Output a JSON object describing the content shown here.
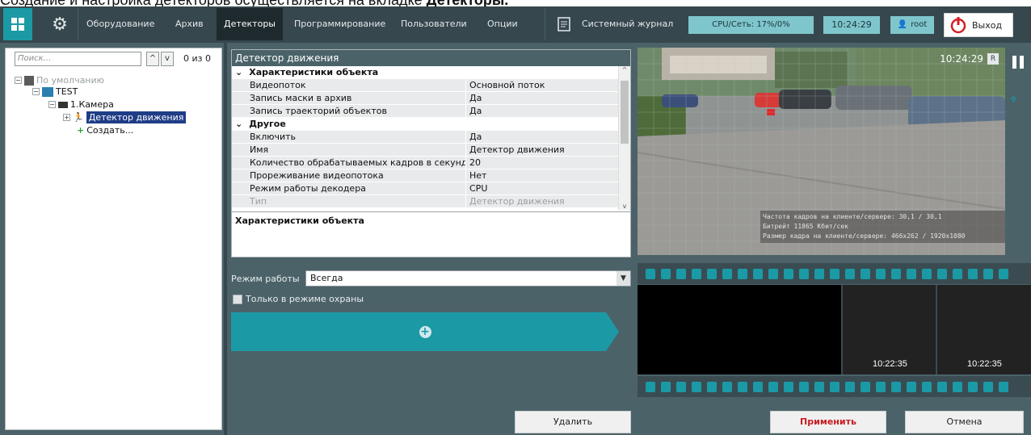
{
  "caption": {
    "text": "Создание и настройка детекторов осуществляется на вкладке ",
    "bold": "Детекторы."
  },
  "topbar": {
    "tabs": [
      "Оборудование",
      "Архив",
      "Детекторы",
      "Программирование",
      "Пользователи",
      "Опции"
    ],
    "active_tab": "Детекторы",
    "journal": "Системный журнал",
    "cpu": "CPU/Сеть: 17%/0%",
    "time": "10:24:29",
    "user": "root",
    "exit": "Выход"
  },
  "tree": {
    "search_placeholder": "Поиск...",
    "count": "0 из 0",
    "items": [
      "По умолчанию",
      "TEST",
      "1.Камера",
      "Детектор движения",
      "Создать..."
    ]
  },
  "props": {
    "title": "Детектор движения",
    "group1": "Характеристики объекта",
    "rows1": [
      {
        "k": "Видеопоток",
        "v": "Основной поток"
      },
      {
        "k": "Запись маски в архив",
        "v": "Да"
      },
      {
        "k": "Запись траекторий объектов",
        "v": "Да"
      }
    ],
    "group2": "Другое",
    "rows2": [
      {
        "k": "Включить",
        "v": "Да"
      },
      {
        "k": "Имя",
        "v": "Детектор движения"
      },
      {
        "k": "Количество обрабатываемых кадров в секунду",
        "v": "20"
      },
      {
        "k": "Прореживание видеопотока",
        "v": "Нет"
      },
      {
        "k": "Режим работы декодера",
        "v": "CPU"
      },
      {
        "k": "Тип",
        "v": "Детектор движения"
      }
    ],
    "description": "Характеристики объекта"
  },
  "mode": {
    "label": "Режим работы",
    "value": "Всегда",
    "guard_label": "Только в режиме охраны"
  },
  "buttons": {
    "delete": "Удалить",
    "apply": "Применить",
    "cancel": "Отмена"
  },
  "video": {
    "time": "10:24:29",
    "r_badge": "R",
    "stat1": "Частота кадров на клиенте/сервере: 30,1 / 30,1",
    "stat2": "Битрейт 11865 Кбит/сек",
    "stat3": "Размер кадра на клиенте/сервере: 466x262 / 1920x1080",
    "frame_times": [
      "10:22:35",
      "10:22:35"
    ]
  },
  "colors": {
    "accent": "#1b9aa6",
    "toolbar": "#36474d",
    "panel": "#4b6268",
    "selection": "#1f3d87",
    "apply": "#c71c22"
  }
}
